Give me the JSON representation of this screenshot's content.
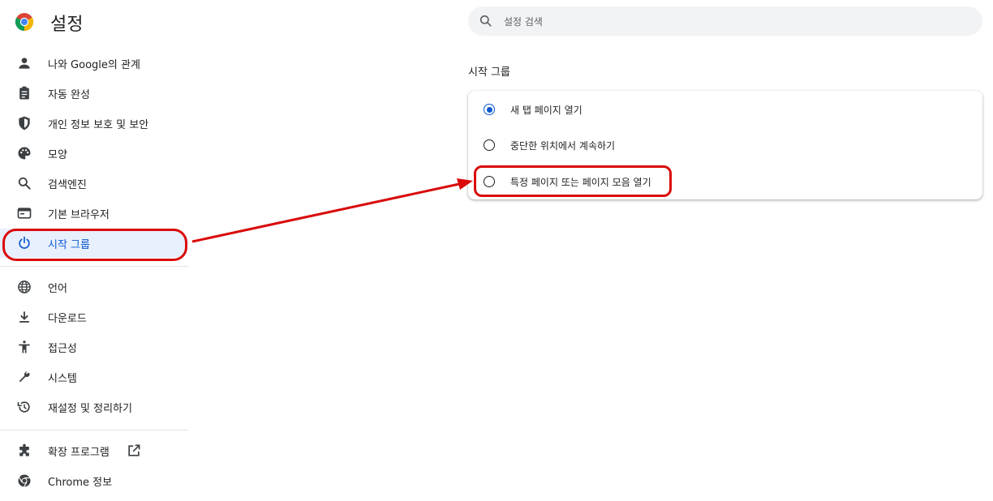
{
  "header": {
    "title": "설정"
  },
  "search": {
    "placeholder": "설정 검색",
    "value": ""
  },
  "sidebar": {
    "items": [
      {
        "label": "나와 Google의 관계",
        "icon": "person-icon"
      },
      {
        "label": "자동 완성",
        "icon": "clipboard-icon"
      },
      {
        "label": "개인 정보 보호 및 보안",
        "icon": "shield-icon"
      },
      {
        "label": "모양",
        "icon": "palette-icon"
      },
      {
        "label": "검색엔진",
        "icon": "search-icon"
      },
      {
        "label": "기본 브라우저",
        "icon": "browser-icon"
      },
      {
        "label": "시작 그룹",
        "icon": "power-icon",
        "active": true
      },
      {
        "label": "언어",
        "icon": "globe-icon"
      },
      {
        "label": "다운로드",
        "icon": "download-icon"
      },
      {
        "label": "접근성",
        "icon": "accessibility-icon"
      },
      {
        "label": "시스템",
        "icon": "wrench-icon"
      },
      {
        "label": "재설정 및 정리하기",
        "icon": "history-icon"
      },
      {
        "label": "확장 프로그램",
        "icon": "puzzle-icon"
      },
      {
        "label": "Chrome 정보",
        "icon": "chrome-icon"
      }
    ]
  },
  "main": {
    "section_title": "시작 그룹",
    "options": [
      {
        "label": "새 탭 페이지 열기",
        "selected": true
      },
      {
        "label": "중단한 위치에서 계속하기",
        "selected": false
      },
      {
        "label": "특정 페이지 또는 페이지 모음 열기",
        "selected": false
      }
    ]
  },
  "colors": {
    "accent": "#0b57d0",
    "active_bg": "#e8f0fe",
    "annotation": "#d90a0a"
  }
}
